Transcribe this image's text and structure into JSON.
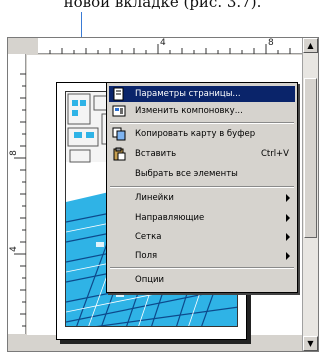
{
  "caption": "новой вкладке (рис. 3.7).",
  "ruler": {
    "h_marks": [
      "4",
      "8"
    ],
    "v_marks": [
      "8",
      "4"
    ]
  },
  "scrollbar": {
    "up_icon": "triangle-up-icon",
    "down_icon": "triangle-down-icon"
  },
  "context_menu": {
    "items": [
      {
        "label": "Параметры страницы...",
        "icon": "page-setup-icon",
        "highlighted": true
      },
      {
        "label": "Изменить компоновку...",
        "icon": "layout-icon"
      },
      {
        "label": "Копировать карту в буфер",
        "icon": "copy-map-icon"
      },
      {
        "label": "Вставить",
        "icon": "paste-icon",
        "shortcut": "Ctrl+V"
      },
      {
        "label": "Выбрать все элементы"
      },
      {
        "label": "Линейки",
        "submenu": true
      },
      {
        "label": "Направляющие",
        "submenu": true
      },
      {
        "label": "Сетка",
        "submenu": true
      },
      {
        "label": "Поля",
        "submenu": true
      },
      {
        "label": "Опции"
      }
    ]
  },
  "colors": {
    "highlight": "#0a246a",
    "menu_bg": "#d6d3ce",
    "map_water": "#2fb3e6"
  }
}
